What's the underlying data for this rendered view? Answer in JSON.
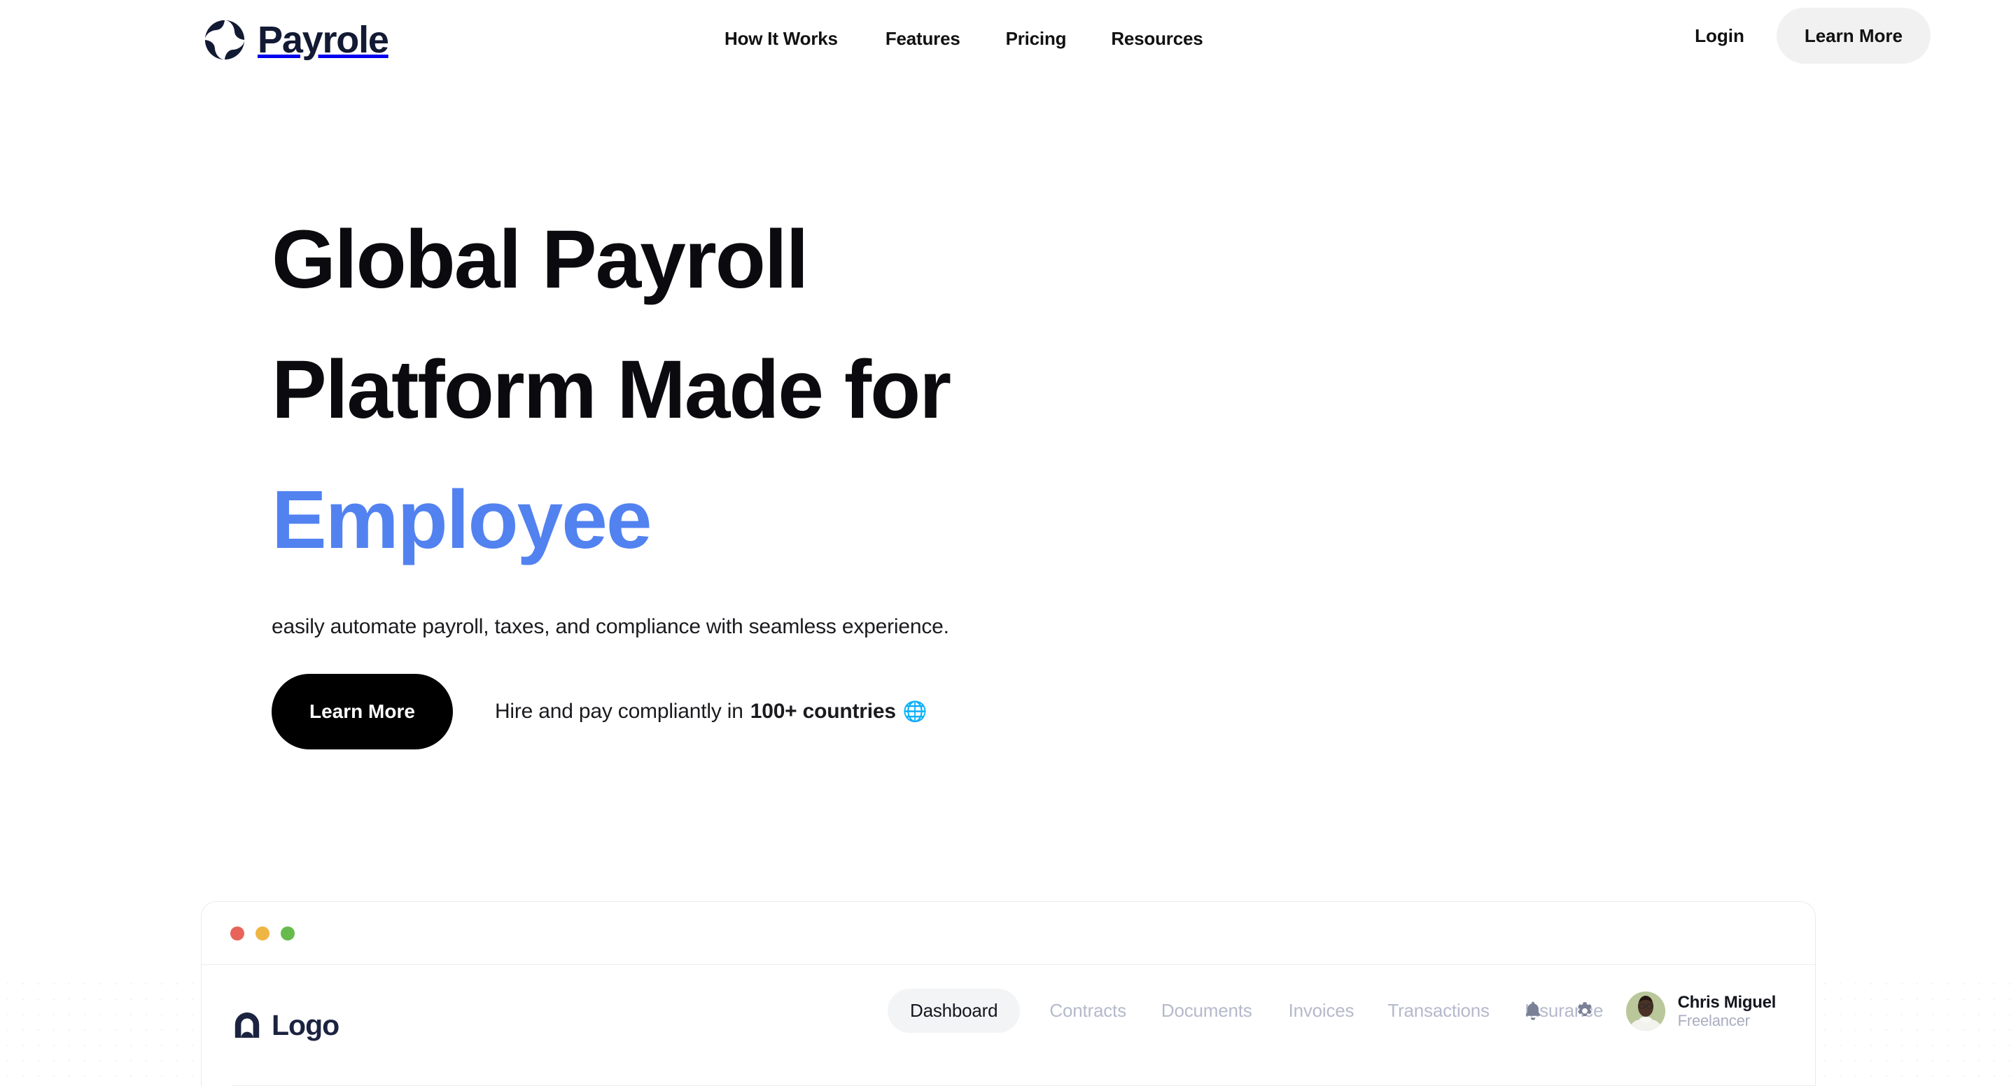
{
  "brand": {
    "name": "Payrole",
    "logo_icon": "payrole-pinwheel-logo",
    "logo_color": "#131a33"
  },
  "nav": {
    "links": [
      {
        "label": "How It Works"
      },
      {
        "label": "Features"
      },
      {
        "label": "Pricing"
      },
      {
        "label": "Resources"
      }
    ],
    "login_label": "Login",
    "cta_label": "Learn More"
  },
  "hero": {
    "title_line1": "Global Payroll",
    "title_line2": "Platform Made for",
    "title_accent": "Employee",
    "accent_color": "#5282f0",
    "subtitle": "easily automate payroll, taxes, and compliance with seamless experience.",
    "cta_label": "Learn More",
    "note_prefix": "Hire and pay compliantly in ",
    "note_strong": "100+ countries",
    "note_icon": "globe-icon",
    "note_emoji": "🌐"
  },
  "mockup": {
    "window_dots": [
      {
        "name": "close",
        "color": "#e8645a"
      },
      {
        "name": "minimize",
        "color": "#efb544"
      },
      {
        "name": "maximize",
        "color": "#66bb4c"
      }
    ],
    "app_logo_icon": "arch-logo-icon",
    "app_logo_text": "Logo",
    "tabs": [
      {
        "label": "Dashboard",
        "active": true
      },
      {
        "label": "Contracts",
        "active": false
      },
      {
        "label": "Documents",
        "active": false
      },
      {
        "label": "Invoices",
        "active": false
      },
      {
        "label": "Transactions",
        "active": false
      },
      {
        "label": "Insurance",
        "active": false
      }
    ],
    "icons": [
      {
        "name": "bell-icon"
      },
      {
        "name": "gear-icon"
      }
    ],
    "user": {
      "name": "Chris Miguel",
      "role": "Freelancer",
      "avatar_bg": "#b9c79a"
    }
  }
}
